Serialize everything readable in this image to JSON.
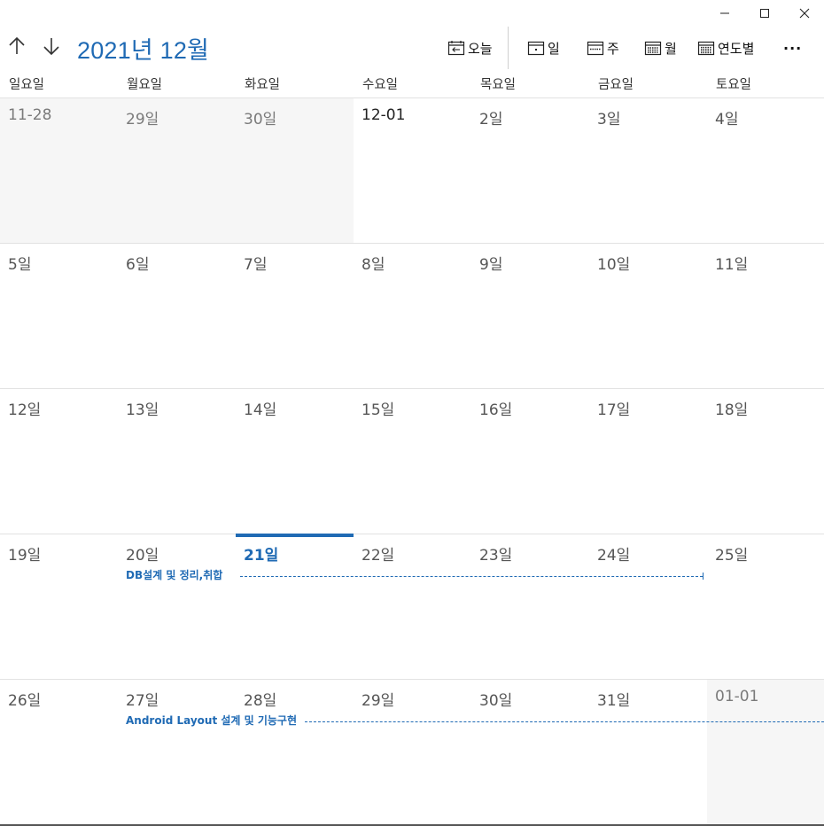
{
  "window": {
    "controls": [
      {
        "icon": "minimize-icon"
      },
      {
        "icon": "maximize-icon"
      },
      {
        "icon": "close-icon"
      }
    ]
  },
  "header": {
    "title": "2021년 12월",
    "nav_icons": [
      "arrow-up-icon",
      "arrow-down-icon"
    ],
    "toolbar": {
      "today": "오늘",
      "day": "일",
      "week": "주",
      "month": "월",
      "year": "연도별",
      "more": "···"
    },
    "accent_color": "#1f6ab4"
  },
  "weekdays": [
    "일요일",
    "월요일",
    "화요일",
    "수요일",
    "목요일",
    "금요일",
    "토요일"
  ],
  "weeks": [
    [
      "11-28",
      "29일",
      "30일",
      "12-01",
      "2일",
      "3일",
      "4일"
    ],
    [
      "5일",
      "6일",
      "7일",
      "8일",
      "9일",
      "10일",
      "11일"
    ],
    [
      "12일",
      "13일",
      "14일",
      "15일",
      "16일",
      "17일",
      "18일"
    ],
    [
      "19일",
      "20일",
      "21일",
      "22일",
      "23일",
      "24일",
      "25일"
    ],
    [
      "26일",
      "27일",
      "28일",
      "29일",
      "30일",
      "31일",
      "01-01"
    ]
  ],
  "today": "21일",
  "events": [
    {
      "title": "DB설계 및 정리,취합"
    },
    {
      "title": "Android Layout 설계 및 기능구현"
    }
  ]
}
